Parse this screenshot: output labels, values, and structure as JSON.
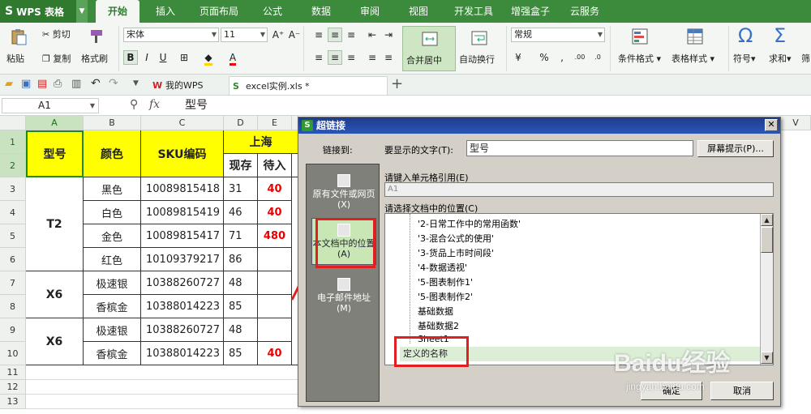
{
  "app": {
    "title": "WPS 表格"
  },
  "tabs": [
    "开始",
    "插入",
    "页面布局",
    "公式",
    "数据",
    "审阅",
    "视图",
    "开发工具",
    "增强盒子",
    "云服务"
  ],
  "ribbon": {
    "paste": "粘贴",
    "cut": "剪切",
    "copy": "复制",
    "format_painter": "格式刷",
    "font_name": "宋体",
    "font_size": "11",
    "merge": "合并居中",
    "wrap": "自动换行",
    "number_format": "常规",
    "cond_format": "条件格式",
    "table_style": "表格样式",
    "symbol": "符号",
    "sum": "求和",
    "more": "筛"
  },
  "quickbar": {
    "doc1": "我的WPS",
    "doc2": "excel实例.xls *"
  },
  "formula": {
    "cell_ref": "A1",
    "fx": "fx",
    "value": "型号"
  },
  "grid": {
    "columns": [
      "A",
      "B",
      "C",
      "D",
      "E",
      "V"
    ],
    "rows": [
      "1",
      "2",
      "3",
      "4",
      "5",
      "6",
      "7",
      "8",
      "9",
      "10",
      "11",
      "12",
      "13"
    ],
    "headers": {
      "model": "型号",
      "color": "颜色",
      "sku": "SKU编码",
      "city": "上海",
      "stock": "现存",
      "pending": "待入"
    },
    "data": [
      {
        "color": "黑色",
        "sku": "10089815418",
        "stock": "31",
        "pending": "40"
      },
      {
        "color": "白色",
        "sku": "10089815419",
        "stock": "46",
        "pending": "40"
      },
      {
        "color": "金色",
        "sku": "10089815417",
        "stock": "71",
        "pending": "480"
      },
      {
        "color": "红色",
        "sku": "10109379217",
        "stock": "86",
        "pending": ""
      },
      {
        "color": "极速银",
        "sku": "10388260727",
        "stock": "48",
        "pending": ""
      },
      {
        "color": "香槟金",
        "sku": "10388014223",
        "stock": "85",
        "pending": ""
      },
      {
        "color": "极速银",
        "sku": "10388260727",
        "stock": "48",
        "pending": ""
      },
      {
        "color": "香槟金",
        "sku": "10388014223",
        "stock": "85",
        "pending": "40"
      }
    ],
    "models": [
      "T2",
      "X6",
      "X6"
    ]
  },
  "dialog": {
    "title": "超链接",
    "link_to": "链接到:",
    "display_text_label": "要显示的文字(T):",
    "display_text_value": "型号",
    "screen_tip": "屏幕提示(P)...",
    "cell_ref_label": "请键入单元格引用(E)",
    "cell_ref_value": "A1",
    "place_label": "请选择文档中的位置(C)",
    "link_items": [
      "原有文件或网页(X)",
      "本文档中的位置(A)",
      "电子邮件地址(M)"
    ],
    "tree_items": [
      "'2-日常工作中的常用函数'",
      "'3-混合公式的使用'",
      "'3-货品上市时间段'",
      "'4-数据透视'",
      "'5-图表制作1'",
      "'5-图表制作2'",
      "基础数据",
      "基础数据2",
      "Sheet1",
      "定义的名称"
    ],
    "ok": "确定",
    "cancel": "取消"
  },
  "watermark": {
    "text": "Baidu经验",
    "url": "jingyan.baidu.com"
  }
}
